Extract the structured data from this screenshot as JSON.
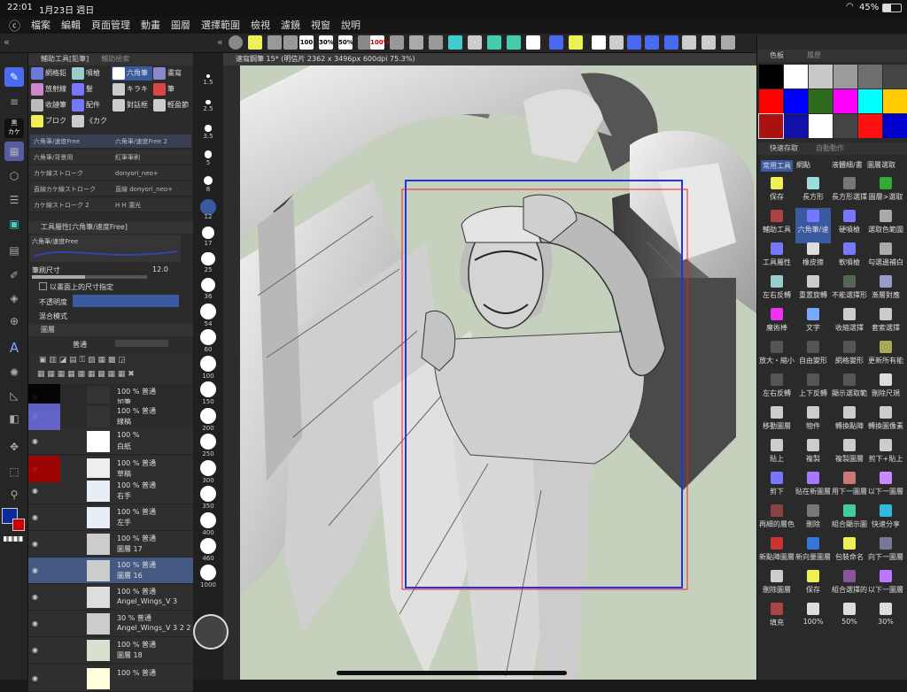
{
  "status": {
    "time": "22:01",
    "date": "1月23日 週日",
    "battery": "45%"
  },
  "menu": [
    "檔案",
    "編輯",
    "頁面管理",
    "動畫",
    "圖層",
    "選擇範圍",
    "檢視",
    "濾鏡",
    "視窗",
    "說明"
  ],
  "cmdbar": {
    "z100": "100",
    "z30": "30%",
    "z50": "50%",
    "z100b": "100%"
  },
  "panels": {
    "subtool_title": "輔助工具[鉛筆]",
    "subtool_tab2": "輔助檢索",
    "toolprop_title": "工具屬性[六角筆/速度Free]",
    "layers_title": "圖層",
    "palette_title": "色板",
    "history_title": "履歷",
    "quick_title": "快速存取",
    "auto_title": "自動動作"
  },
  "subtools": [
    {
      "label": "網格鉛",
      "color": "#6b7bdc"
    },
    {
      "label": "噴槍",
      "color": "#9cc"
    },
    {
      "label": "六角筆",
      "color": "#fff"
    },
    {
      "label": "畫寫",
      "color": "#88c"
    },
    {
      "label": "放射線",
      "color": "#c8c"
    },
    {
      "label": "髮",
      "color": "#77f"
    },
    {
      "label": "キラキ",
      "color": "#ccc"
    },
    {
      "label": "筆",
      "color": "#d44"
    },
    {
      "label": "收鏈筆",
      "color": "#bbb"
    },
    {
      "label": "配件",
      "color": "#77f"
    },
    {
      "label": "對話框",
      "color": "#ccc"
    },
    {
      "label": "輕盈節",
      "color": "#ccc"
    },
    {
      "label": "ブロク",
      "color": "#ee5"
    },
    {
      "label": "《カク",
      "color": "#ccc"
    }
  ],
  "brushes": [
    {
      "left": "六角筆/速度Free",
      "right": "六角筆/速度Free 2"
    },
    {
      "left": "六角筆/背景用",
      "right": "紅筆筆刷"
    },
    {
      "left": "カケ線ストローク",
      "right": "donyori_neo+"
    },
    {
      "left": "直線カケ線ストローク",
      "right": "直線 donyori_neo+"
    },
    {
      "left": "カケ線ストローク 2",
      "right": "H H 濃光"
    }
  ],
  "toolprop": {
    "preview": "六角筆/速度Free",
    "size_label": "筆刷尺寸",
    "size_value": "12.0",
    "check_label": "以畫面上的尺寸指定",
    "opacity_label": "不透明度",
    "blend_label": "混合模式"
  },
  "sizes": [
    "1.5",
    "2.5",
    "3.5",
    "5",
    "8",
    "12",
    "17",
    "25",
    "36",
    "54",
    "60",
    "100",
    "150",
    "200",
    "250",
    "300",
    "350",
    "400",
    "460",
    "1000"
  ],
  "layers_ctrl": {
    "mode": "普通"
  },
  "layers": [
    {
      "pct": "100 %",
      "mode": "普通",
      "name": "加筆"
    },
    {
      "pct": "100 %",
      "mode": "普通",
      "name": "線稿"
    },
    {
      "pct": "100 %",
      "mode": "",
      "name": "白紙"
    },
    {
      "pct": "100 %",
      "mode": "普通",
      "name": "草稿"
    },
    {
      "pct": "100 %",
      "mode": "普通",
      "name": "右手"
    },
    {
      "pct": "100 %",
      "mode": "普通",
      "name": "左手"
    },
    {
      "pct": "100 %",
      "mode": "普通",
      "name": "圖層 17"
    },
    {
      "pct": "100 %",
      "mode": "普通",
      "name": "圖層 16"
    },
    {
      "pct": "100 %",
      "mode": "普通",
      "name": "Angel_Wings_V 3"
    },
    {
      "pct": "30 %",
      "mode": "普通",
      "name": "Angel_Wings_V 3 2 2"
    },
    {
      "pct": "100 %",
      "mode": "普通",
      "name": "圖層 18"
    },
    {
      "pct": "100 %",
      "mode": "普通",
      "name": ""
    }
  ],
  "doc_title": "速寫鋼筆 15* (明信片 2362 x 3496px 600dpi 75.3%)",
  "palette": [
    "#000000",
    "#ffffff",
    "#c8c8c8",
    "#9b9b9b",
    "#6e6e6e",
    "#444444",
    "#ff0000",
    "#0000ff",
    "#2f6b1f",
    "#ff00ff",
    "#00ffff",
    "#ffcc00",
    "#aa1111",
    "#1111aa",
    "#ffffff",
    "#444444",
    "#ff1111",
    "#0000cc"
  ],
  "quick_tabs": [
    "常用工具",
    "網點",
    "液體細/書",
    "圖層選取"
  ],
  "quick": [
    {
      "label": "保存",
      "color": "#ee5"
    },
    {
      "label": "長方形",
      "color": "#9dd"
    },
    {
      "label": "長方形選擇",
      "color": "#777"
    },
    {
      "label": "圖層>選取",
      "color": "#3a3"
    },
    {
      "label": "輔助工具",
      "color": "#a44"
    },
    {
      "label": "六角筆/速",
      "color": "#77f"
    },
    {
      "label": "硬噴槍",
      "color": "#77f"
    },
    {
      "label": "選取色範圍",
      "color": "#aaa"
    },
    {
      "label": "工具屬性",
      "color": "#77f"
    },
    {
      "label": "橡皮擦",
      "color": "#ddd"
    },
    {
      "label": "軟噴槍",
      "color": "#77f"
    },
    {
      "label": "勾選邊補白",
      "color": "#aaa"
    },
    {
      "label": "左右反轉",
      "color": "#9cc"
    },
    {
      "label": "重置旋轉",
      "color": "#ccc"
    },
    {
      "label": "不能選擇形",
      "color": "#565"
    },
    {
      "label": "漸層對應",
      "color": "#99c"
    },
    {
      "label": "魔術棒",
      "color": "#e3e"
    },
    {
      "label": "文字",
      "color": "#7af"
    },
    {
      "label": "收縮選擇",
      "color": "#ccc"
    },
    {
      "label": "套索選擇",
      "color": "#ccc"
    },
    {
      "label": "放大・縮小",
      "color": "#555"
    },
    {
      "label": "自由變形",
      "color": "#555"
    },
    {
      "label": "網格變形",
      "color": "#555"
    },
    {
      "label": "更新所有能",
      "color": "#aa5"
    },
    {
      "label": "左右反轉",
      "color": "#555"
    },
    {
      "label": "上下反轉",
      "color": "#555"
    },
    {
      "label": "顯示選取範",
      "color": "#555"
    },
    {
      "label": "刪除尺規",
      "color": "#ddd"
    },
    {
      "label": "移動圖層",
      "color": "#ccc"
    },
    {
      "label": "物件",
      "color": "#ccc"
    },
    {
      "label": "轉換點陣",
      "color": "#ccc"
    },
    {
      "label": "轉換圖像素材",
      "color": "#ccc"
    },
    {
      "label": "貼上",
      "color": "#ccc"
    },
    {
      "label": "複製",
      "color": "#ccc"
    },
    {
      "label": "複製圖層",
      "color": "#ccc"
    },
    {
      "label": "剪下+貼上",
      "color": "#ccc"
    },
    {
      "label": "剪下",
      "color": "#77f"
    },
    {
      "label": "貼在新圖層",
      "color": "#a7f"
    },
    {
      "label": "用下一圖層",
      "color": "#c77"
    },
    {
      "label": "以下一圖層",
      "color": "#c8f"
    },
    {
      "label": "再細的層色",
      "color": "#844"
    },
    {
      "label": "刪除",
      "color": "#777"
    },
    {
      "label": "組合顯示圖",
      "color": "#4c9"
    },
    {
      "label": "快速分享",
      "color": "#3bd"
    },
    {
      "label": "新點陣圖層",
      "color": "#c33"
    },
    {
      "label": "新向量圖層",
      "color": "#37d"
    },
    {
      "label": "包裝命名",
      "color": "#ee5"
    },
    {
      "label": "向下一圖層",
      "color": "#779"
    },
    {
      "label": "刪除圖層",
      "color": "#ccc"
    },
    {
      "label": "保存",
      "color": "#ee5"
    },
    {
      "label": "組合選擇的",
      "color": "#859"
    },
    {
      "label": "以下一圖層",
      "color": "#b7f"
    },
    {
      "label": "填充",
      "color": "#a44"
    },
    {
      "label": "100%",
      "color": "#ddd"
    },
    {
      "label": "50%",
      "color": "#ddd"
    },
    {
      "label": "30%",
      "color": "#ddd"
    }
  ]
}
